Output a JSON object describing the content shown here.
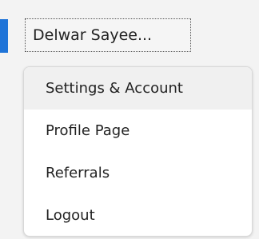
{
  "header": {
    "account_button_label": "Delwar Sayee..."
  },
  "menu": {
    "items": [
      {
        "label": "Settings & Account",
        "highlighted": true
      },
      {
        "label": "Profile Page",
        "highlighted": false
      },
      {
        "label": "Referrals",
        "highlighted": false
      },
      {
        "label": "Logout",
        "highlighted": false
      }
    ]
  },
  "colors": {
    "accent": "#1f74d8",
    "background": "#f3f3f3",
    "menu_background": "#ffffff",
    "menu_highlight": "#f0f0f0",
    "text": "#222222"
  }
}
